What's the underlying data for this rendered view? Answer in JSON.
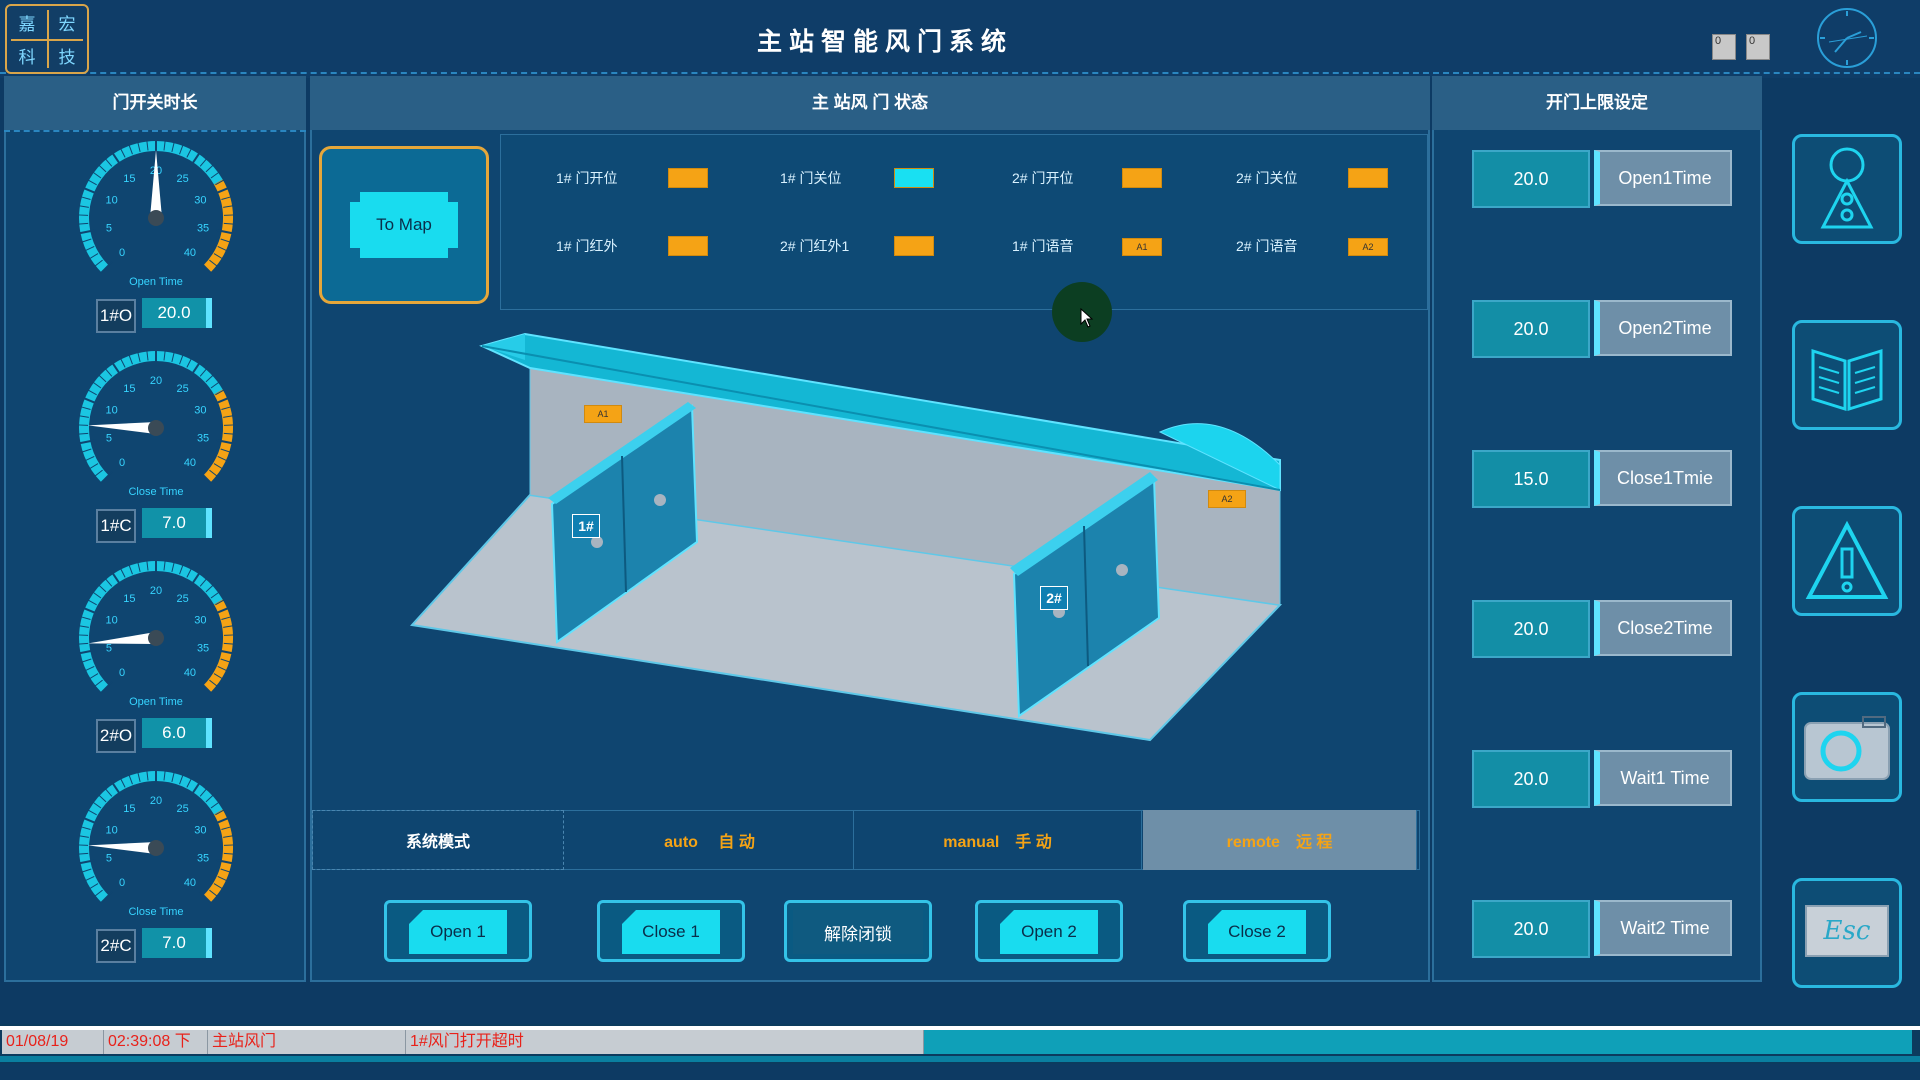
{
  "header": {
    "title": "主站智能风门系统",
    "logo_chars": [
      "嘉",
      "宏",
      "科",
      "技"
    ],
    "box1": "0",
    "box2": "0"
  },
  "left_panel": {
    "title": "门开关时长",
    "gauges": [
      {
        "label": "Open Time",
        "tag": "1#O",
        "value": "20.0",
        "needle": 20
      },
      {
        "label": "Close Time",
        "tag": "1#C",
        "value": "7.0",
        "needle": 7
      },
      {
        "label": "Open Time",
        "tag": "2#O",
        "value": "6.0",
        "needle": 6
      },
      {
        "label": "Close Time",
        "tag": "2#C",
        "value": "7.0",
        "needle": 7
      }
    ],
    "gauge_ticks": [
      "0",
      "5",
      "10",
      "15",
      "20",
      "25",
      "30",
      "35",
      "40"
    ]
  },
  "center_panel": {
    "title": "主 站风 门 状态",
    "to_map": "To Map",
    "indicators": [
      {
        "label": "1# 门开位",
        "color": "#f5a315",
        "text": ""
      },
      {
        "label": "1# 门关位",
        "color": "#19e0f2",
        "text": ""
      },
      {
        "label": "2# 门开位",
        "color": "#f5a315",
        "text": ""
      },
      {
        "label": "2# 门关位",
        "color": "#f5a315",
        "text": ""
      },
      {
        "label": "1# 门红外",
        "color": "#f5a315",
        "text": ""
      },
      {
        "label": "2# 门红外1",
        "color": "#f5a315",
        "text": ""
      },
      {
        "label": "1# 门语音",
        "color": "#f5a315",
        "text": "A1"
      },
      {
        "label": "2# 门语音",
        "color": "#f5a315",
        "text": "A2"
      }
    ],
    "scene": {
      "tag_a1": "A1",
      "tag_a2": "A2",
      "door1": "1#",
      "door2": "2#"
    },
    "mode": {
      "label": "系统模式",
      "auto": "auto　 自 动",
      "manual": "manual　手 动",
      "remote": "remote　远 程"
    },
    "buttons": [
      "Open 1",
      "Close 1",
      "解除闭锁",
      "Open 2",
      "Close 2"
    ]
  },
  "right_panel": {
    "title": "开门上限设定",
    "settings": [
      {
        "value": "20.0",
        "label": "Open1Time"
      },
      {
        "value": "20.0",
        "label": "Open2Time"
      },
      {
        "value": "15.0",
        "label": "Close1Tmie"
      },
      {
        "value": "20.0",
        "label": "Close2Time"
      },
      {
        "value": "20.0",
        "label": "Wait1 Time"
      },
      {
        "value": "20.0",
        "label": "Wait2 Time"
      }
    ]
  },
  "side_icons": [
    "person-light-icon",
    "book-icon",
    "warning-icon",
    "camera-icon",
    "esc-icon"
  ],
  "esc_label": "Esc",
  "status_bar": {
    "date": "01/08/19",
    "time": "02:39:08 下",
    "location": "主站风门",
    "message": "1#风门打开超时"
  }
}
